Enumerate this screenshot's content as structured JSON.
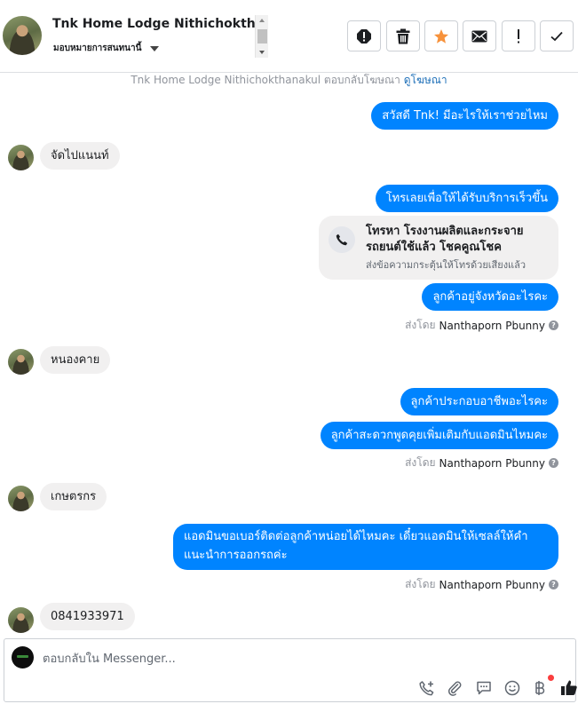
{
  "header": {
    "contact_name": "Tnk Home Lodge Nithichokthanakul",
    "assign_label": "มอบหมายการสนทนานี้",
    "toolbar": [
      "spam-icon",
      "trash-icon",
      "star-icon",
      "envelope-icon",
      "exclamation-icon",
      "check-icon"
    ]
  },
  "thread": {
    "ad_note": "Tnk Home Lodge Nithichokthanakul ตอบกลับโฆษณา",
    "ad_link": "ดูโฆษณา",
    "messages": [
      {
        "dir": "out",
        "text": "สวัสดี Tnk! มีอะไรให้เราช่วยไหม"
      },
      {
        "dir": "in",
        "text": "จัดไปแนนท์"
      },
      {
        "dir": "out",
        "text": "โทรเลยเพื่อให้ได้รับบริการเร็วขึ้น"
      },
      {
        "dir": "out",
        "text": "ลูกค้าอยู่จังหวัดอะไรคะ"
      },
      {
        "dir": "in",
        "text": "หนองคาย"
      },
      {
        "dir": "out",
        "text": "ลูกค้าประกอบอาชีพอะไรคะ"
      },
      {
        "dir": "out",
        "text": "ลูกค้าสะดวกพูดคุยเพิ่มเติมกับแอดมินไหมคะ"
      },
      {
        "dir": "in",
        "text": "เกษตรกร"
      },
      {
        "dir": "out",
        "text": "แอดมินขอเบอร์ติดต่อลูกค้าหน่อยได้ไหมคะ เดี๋ยวแอดมินให้เซลล์ให้คำ แนะนำการออกรถค่ะ"
      },
      {
        "dir": "in",
        "text": "0841933971"
      }
    ],
    "call_card": {
      "title": "โทรหา โรงงานผลิตและกระจาย รถยนต์ใช้แล้ว โชคคูณโชค",
      "subtitle": "ส่งข้อความกระตุ้นให้โทรด้วยเสียงแล้ว"
    },
    "sent_by_label": "ส่งโดย",
    "sent_by_name": "Nanthaporn Pbunny"
  },
  "composer": {
    "placeholder": "ตอบกลับใน Messenger...",
    "value": "",
    "icons": [
      "add-call-icon",
      "attachment-icon",
      "saved-replies-icon",
      "emoji-icon",
      "baht-payment-icon",
      "thumbs-up-icon"
    ]
  },
  "colors": {
    "outgoing_bubble": "#0084ff",
    "incoming_bubble": "#f1f0f0",
    "star": "#f7923b",
    "link": "#1d6fb8"
  }
}
